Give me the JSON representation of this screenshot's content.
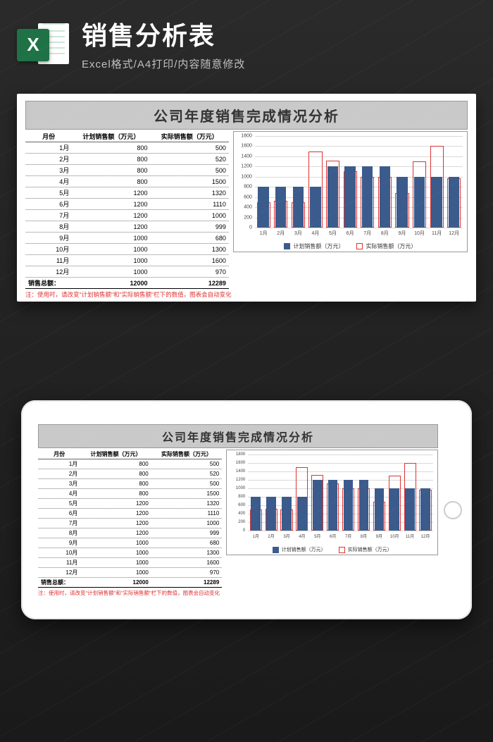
{
  "hero": {
    "icon_letter": "X",
    "title": "销售分析表",
    "subtitle": "Excel格式/A4打印/内容随意修改"
  },
  "sheet": {
    "title": "公司年度销售完成情况分析",
    "columns": [
      "月份",
      "计划销售额（万元）",
      "实际销售额（万元）"
    ],
    "total_label": "销售总额：",
    "total_plan": 12000,
    "total_actual": 12289,
    "note": "注：使用时，请改变\"计划销售额\"和\"实际销售额\"栏下的数值，图表会自动变化"
  },
  "legend": {
    "plan": "计划销售额（万元）",
    "actual": "实际销售额（万元）"
  },
  "chart_data": {
    "type": "bar",
    "categories": [
      "1月",
      "2月",
      "3月",
      "4月",
      "5月",
      "6月",
      "7月",
      "8月",
      "9月",
      "10月",
      "11月",
      "12月"
    ],
    "series": [
      {
        "name": "计划销售额（万元）",
        "values": [
          800,
          800,
          800,
          800,
          1200,
          1200,
          1200,
          1200,
          1000,
          1000,
          1000,
          1000
        ]
      },
      {
        "name": "实际销售额（万元）",
        "values": [
          500,
          520,
          500,
          1500,
          1320,
          1110,
          1000,
          999,
          680,
          1300,
          1600,
          970
        ]
      }
    ],
    "ylim": [
      0,
      1800
    ],
    "ystep": 200,
    "xlabel": "",
    "ylabel": ""
  }
}
